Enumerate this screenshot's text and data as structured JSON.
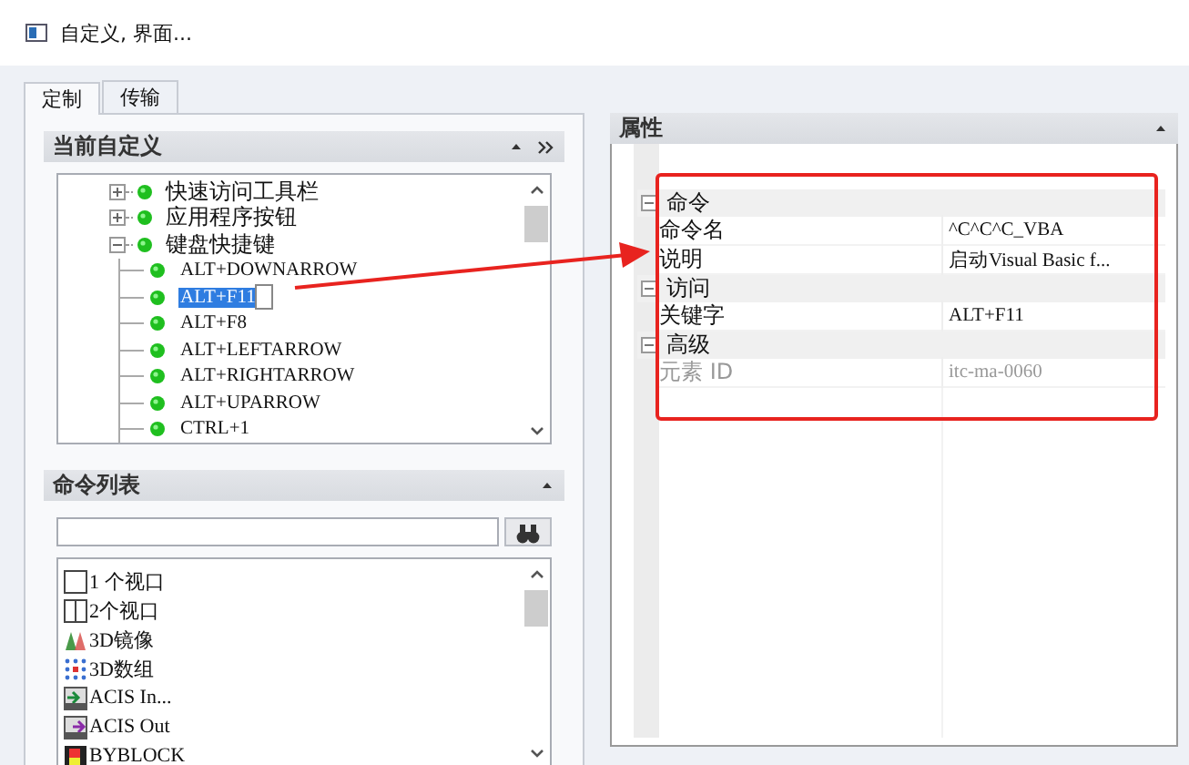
{
  "window": {
    "title": "自定义, 界面..."
  },
  "tabs": [
    {
      "label": "定制",
      "selected": true
    },
    {
      "label": "传输",
      "selected": false
    }
  ],
  "customizations": {
    "title": "当前自定义",
    "tree": [
      {
        "label": "快速访问工具栏",
        "expanded": false,
        "selected": false
      },
      {
        "label": "应用程序按钮",
        "expanded": false,
        "selected": false
      },
      {
        "label": "键盘快捷键",
        "expanded": true,
        "selected": false,
        "children": [
          {
            "label": "ALT+DOWNARROW",
            "selected": false
          },
          {
            "label": "ALT+F11",
            "selected": true
          },
          {
            "label": "ALT+F8",
            "selected": false
          },
          {
            "label": "ALT+LEFTARROW",
            "selected": false
          },
          {
            "label": "ALT+RIGHTARROW",
            "selected": false
          },
          {
            "label": "ALT+UPARROW",
            "selected": false
          },
          {
            "label": "CTRL+1",
            "selected": false
          }
        ]
      }
    ]
  },
  "command_list": {
    "title": "命令列表",
    "items": [
      {
        "label": "1 个视口"
      },
      {
        "label": "2个视口"
      },
      {
        "label": "3D镜像"
      },
      {
        "label": "3D数组"
      },
      {
        "label": "ACIS In..."
      },
      {
        "label": "ACIS Out"
      },
      {
        "label": "BYBLOCK"
      }
    ]
  },
  "properties": {
    "title": "属性",
    "groups": [
      {
        "label": "命令",
        "expanded": true,
        "rows": [
          {
            "name": "命令名",
            "value": "^C^C^C_VBA",
            "disabled": false
          },
          {
            "name": "说明",
            "value": "启动Visual Basic f...",
            "disabled": false
          }
        ]
      },
      {
        "label": "访问",
        "expanded": true,
        "rows": [
          {
            "name": "关键字",
            "value": "ALT+F11",
            "disabled": false
          }
        ]
      },
      {
        "label": "高级",
        "expanded": true,
        "rows": [
          {
            "name": "元素 ID",
            "value": "itc-ma-0060",
            "disabled": true
          }
        ]
      }
    ]
  }
}
